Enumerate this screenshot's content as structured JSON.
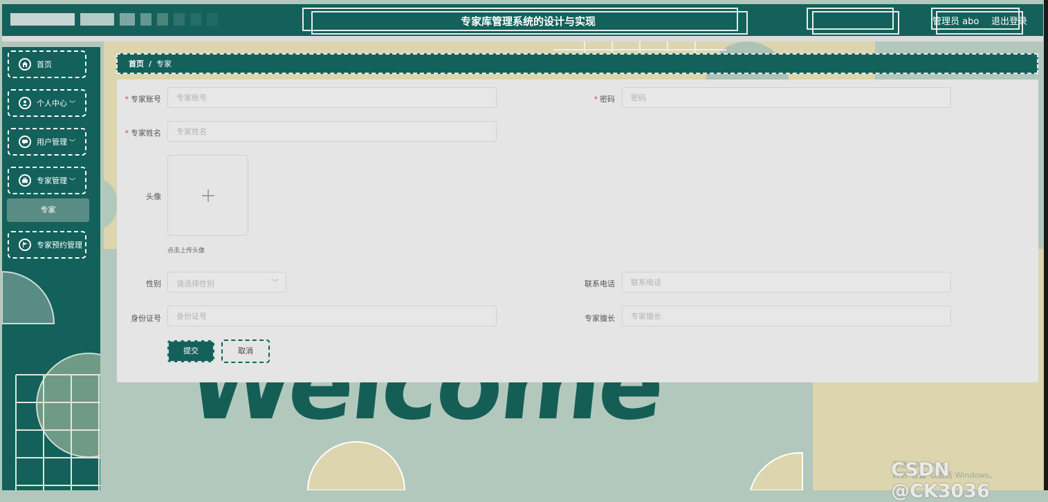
{
  "header": {
    "title": "专家库管理系统的设计与实现",
    "user": "管理员 abo",
    "logout": "退出登录"
  },
  "sidebar": {
    "items": [
      {
        "label": "首页",
        "icon": "home-icon"
      },
      {
        "label": "个人中心",
        "icon": "user-icon",
        "has_children": true
      },
      {
        "label": "用户管理",
        "icon": "chat-icon",
        "has_children": true
      },
      {
        "label": "专家管理",
        "icon": "briefcase-icon",
        "has_children": true
      },
      {
        "label": "专家预约管理",
        "icon": "flag-icon"
      }
    ],
    "active_sub": "专家"
  },
  "breadcrumb": {
    "home": "首页",
    "sep": "/",
    "current": "专家"
  },
  "form": {
    "account": {
      "label": "专家账号",
      "placeholder": "专家账号",
      "required": true
    },
    "password": {
      "label": "密码",
      "placeholder": "密码",
      "required": true
    },
    "name": {
      "label": "专家姓名",
      "placeholder": "专家姓名",
      "required": true
    },
    "avatar": {
      "label": "头像",
      "hint": "点击上传头像"
    },
    "gender": {
      "label": "性别",
      "placeholder": "请选择性别"
    },
    "phone": {
      "label": "联系电话",
      "placeholder": "联系电话"
    },
    "idcard": {
      "label": "身份证号",
      "placeholder": "身份证号"
    },
    "specialty": {
      "label": "专家擅长",
      "placeholder": "专家擅长"
    },
    "submit": "提交",
    "cancel": "取消"
  },
  "background": {
    "welcome": "Welcome"
  },
  "watermark": {
    "csdn": "CSDN @CK3036",
    "windows_line1": "激活 Windows",
    "windows_line2": "转到\"设置\"以激活 Windows。"
  },
  "colors": {
    "primary": "#13615a",
    "panel": "#e5e5e5",
    "bg_sage": "#b3c8bd",
    "bg_sand": "#ddd5ad",
    "required": "#e0443c"
  }
}
